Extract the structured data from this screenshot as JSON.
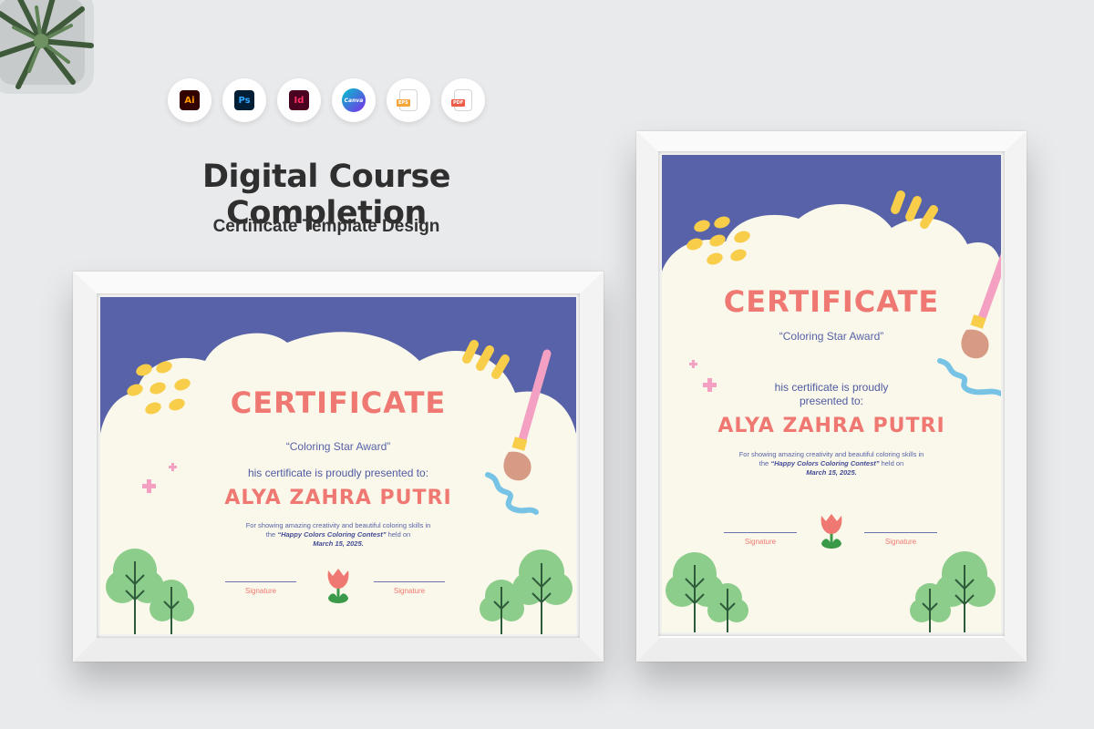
{
  "header": {
    "title": "Digital Course Completion",
    "subtitle": "Certificate Template Design"
  },
  "app_icons": [
    {
      "name": "illustrator-icon",
      "label": "Ai"
    },
    {
      "name": "photoshop-icon",
      "label": "Ps"
    },
    {
      "name": "indesign-icon",
      "label": "Id"
    },
    {
      "name": "canva-icon",
      "label": "Canva"
    },
    {
      "name": "eps-file-icon",
      "label": "EPS"
    },
    {
      "name": "pdf-file-icon",
      "label": "PDF"
    }
  ],
  "certificate": {
    "heading": "Certificate",
    "award": "“Coloring Star Award”",
    "presented_landscape": "his certificate is proudly presented to:",
    "presented_portrait_1": "his certificate is proudly",
    "presented_portrait_2": "presented to:",
    "recipient": "ALYA ZAHRA PUTRI",
    "body_1": "For showing amazing creativity and beautiful coloring skills in",
    "body_2_pre": "the ",
    "contest": "“Happy Colors Coloring Contest”",
    "body_2_post": " held on",
    "date": "March 15, 2025.",
    "signature_left": "Signature",
    "signature_right": "Signature"
  },
  "colors": {
    "sky": "#5762a8",
    "cloud": "#faf8ea",
    "accent_coral": "#ef7872",
    "yellow": "#f7cd4a",
    "tree_green": "#8ccd8c",
    "pink": "#f3a0c2"
  }
}
